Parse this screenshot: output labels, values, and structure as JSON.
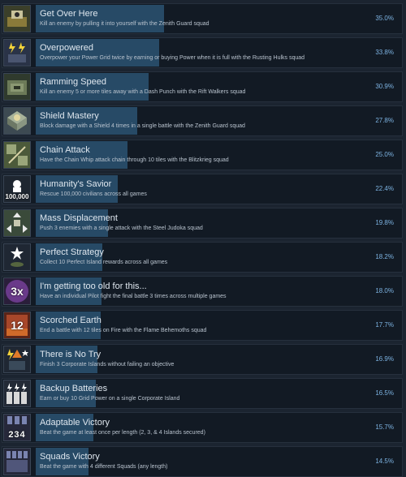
{
  "achievements": [
    {
      "title": "Get Over Here",
      "description": "Kill an enemy by pulling it into yourself with the Zenith Guard squad",
      "percent": "35.0%",
      "fill": 0.35,
      "icon": "mech-pull-icon",
      "icon_text": "",
      "icon_colors": [
        "#3b3f2a",
        "#8a7a3a"
      ]
    },
    {
      "title": "Overpowered",
      "description": "Overpower your Power Grid twice by earning or buying Power when it is full with the Rusting Hulks squad",
      "percent": "33.8%",
      "fill": 0.338,
      "icon": "lightning-grid-icon",
      "icon_text": "",
      "icon_colors": [
        "#2a3347",
        "#c7a22a"
      ]
    },
    {
      "title": "Ramming Speed",
      "description": "Kill an enemy 5 or more tiles away with a Dash Punch with the Rift Walkers squad",
      "percent": "30.9%",
      "fill": 0.309,
      "icon": "ramming-mech-icon",
      "icon_text": "",
      "icon_colors": [
        "#2f3a2d",
        "#6c7a58"
      ]
    },
    {
      "title": "Shield Mastery",
      "description": "Block damage with a Shield 4 times in a single battle with the Zenith Guard squad",
      "percent": "27.8%",
      "fill": 0.278,
      "icon": "shield-tile-icon",
      "icon_colors": [
        "#3d4a52",
        "#a8b39a"
      ]
    },
    {
      "title": "Chain Attack",
      "description": "Have the Chain Whip attack chain through 10 tiles with the Blitzkrieg squad",
      "percent": "25.0%",
      "fill": 0.25,
      "icon": "chain-whip-icon",
      "icon_colors": [
        "#4c5a3a",
        "#9aa67a"
      ]
    },
    {
      "title": "Humanity's Savior",
      "description": "Rescue 100,000 civilians across all games",
      "percent": "22.4%",
      "fill": 0.224,
      "icon": "civilians-icon",
      "icon_text": "100,000",
      "icon_colors": [
        "#1e2630",
        "#3a4656"
      ]
    },
    {
      "title": "Mass Displacement",
      "description": "Push 3 enemies with a single attack with the Steel Judoka squad",
      "percent": "19.8%",
      "fill": 0.198,
      "icon": "push-arrows-icon",
      "icon_colors": [
        "#3a4a3a",
        "#7a8a6a"
      ]
    },
    {
      "title": "Perfect Strategy",
      "description": "Collect 10 Perfect Island rewards across all games",
      "percent": "18.2%",
      "fill": 0.182,
      "icon": "star-island-icon",
      "icon_colors": [
        "#1f2733",
        "#55653f"
      ]
    },
    {
      "title": "I'm getting too old for this...",
      "description": "Have an individual Pilot fight the final battle 3 times across multiple games",
      "percent": "18.0%",
      "fill": 0.18,
      "icon": "times-three-icon",
      "icon_text": "3x",
      "icon_colors": [
        "#2a1e3a",
        "#6a3a8a"
      ]
    },
    {
      "title": "Scorched Earth",
      "description": "End a battle with 12 tiles on Fire with the Flame Behemoths squad",
      "percent": "17.7%",
      "fill": 0.177,
      "icon": "fire-tiles-icon",
      "icon_text": "12",
      "icon_colors": [
        "#5a2418",
        "#a8472a"
      ]
    },
    {
      "title": "There is No Try",
      "description": "Finish 3 Corporate Islands without failing an objective",
      "percent": "16.9%",
      "fill": 0.169,
      "icon": "objectives-icon",
      "icon_colors": [
        "#1f2733",
        "#2e3a4a"
      ]
    },
    {
      "title": "Backup Batteries",
      "description": "Earn or buy 10 Grid Power on a single Corporate Island",
      "percent": "16.5%",
      "fill": 0.165,
      "icon": "batteries-icon",
      "icon_colors": [
        "#232a36",
        "#3a4454"
      ]
    },
    {
      "title": "Adaptable Victory",
      "description": "Beat the game at least once per length (2, 3, & 4 Islands secured)",
      "percent": "15.7%",
      "fill": 0.157,
      "icon": "medals-234-icon",
      "icon_text": "234",
      "icon_colors": [
        "#26283a",
        "#4a4f70"
      ]
    },
    {
      "title": "Squads Victory",
      "description": "Beat the game with 4 different Squads (any length)",
      "percent": "14.5%",
      "fill": 0.145,
      "icon": "squad-medals-icon",
      "icon_colors": [
        "#26283a",
        "#50567a"
      ]
    }
  ]
}
